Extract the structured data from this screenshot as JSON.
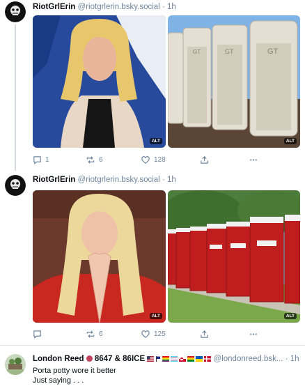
{
  "posts": [
    {
      "author_name": "RiotGrlErin",
      "handle": "@riotgrlerin.bsky.social",
      "sep": "·",
      "time": "1h",
      "images": [
        {
          "alt_badge": "ALT"
        },
        {
          "alt_badge": "ALT"
        }
      ],
      "replies": "1",
      "reposts": "6",
      "likes": "128"
    },
    {
      "author_name": "RiotGrlErin",
      "handle": "@riotgrlerin.bsky.social",
      "sep": "·",
      "time": "1h",
      "images": [
        {
          "alt_badge": "ALT"
        },
        {
          "alt_badge": "ALT"
        }
      ],
      "replies": "",
      "reposts": "6",
      "likes": "125"
    },
    {
      "author_name": "London Reed",
      "name_suffix": "8647 & 86ICE",
      "handle": "@londonreed.bsk...",
      "sep": "·",
      "time": "1h",
      "text_line1": "Porta potty wore it better",
      "text_line2": "Just saying . . ."
    }
  ],
  "icons": [
    "reply-icon",
    "repost-icon",
    "like-icon",
    "share-icon",
    "more-icon"
  ]
}
